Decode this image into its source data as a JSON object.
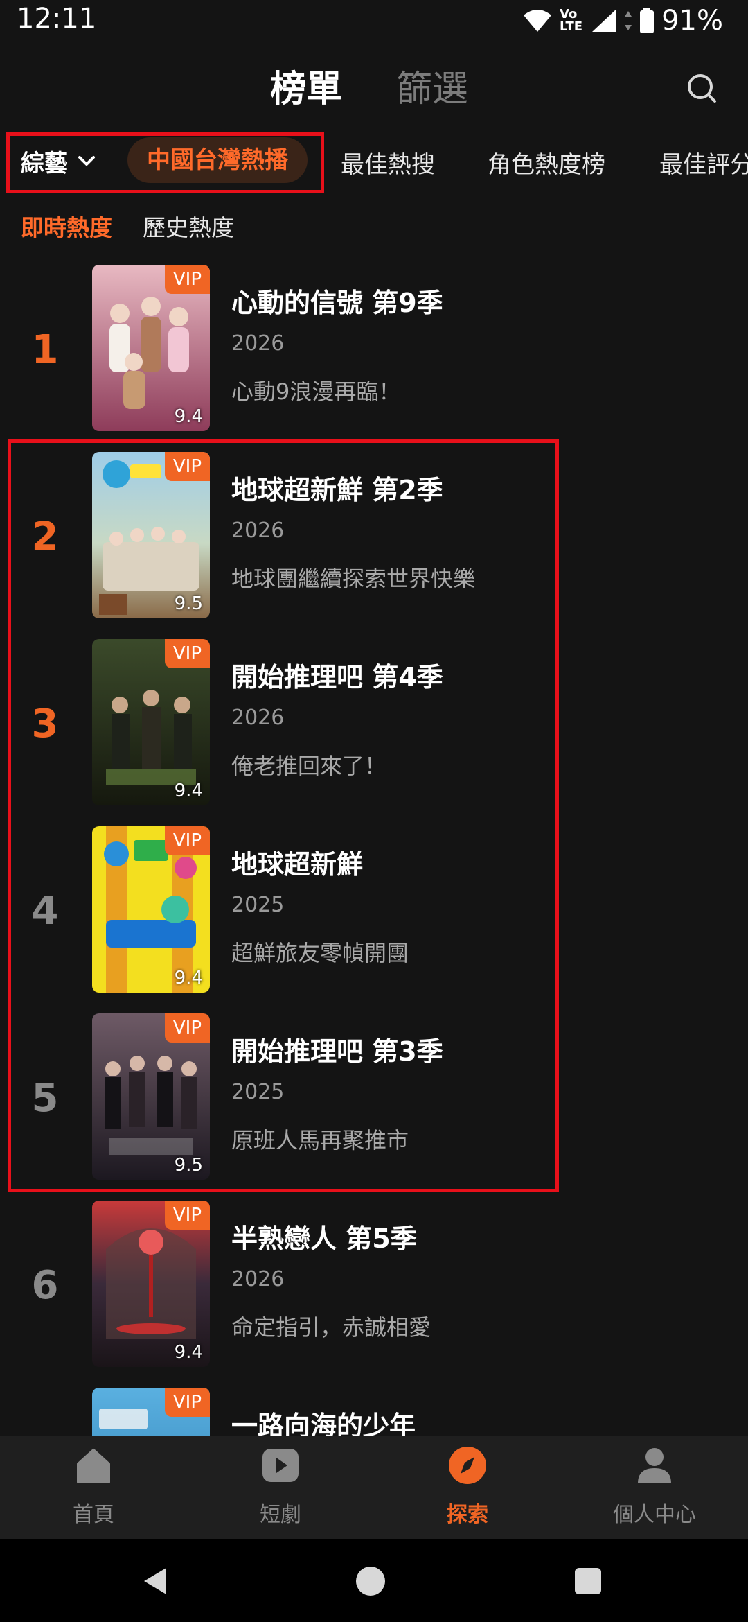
{
  "status_bar": {
    "time": "12:11",
    "battery": "91%"
  },
  "header": {
    "tabs": [
      {
        "label": "榜單",
        "active": true
      },
      {
        "label": "篩選",
        "active": false
      }
    ],
    "search_icon": "search-icon"
  },
  "category_row": {
    "dropdown_label": "綜藝",
    "selected": "中國台灣熱播",
    "items": [
      "最佳熱搜",
      "角色熱度榜",
      "最佳評分"
    ]
  },
  "sub_tabs": [
    {
      "label": "即時熱度",
      "active": true
    },
    {
      "label": "歷史熱度",
      "active": false
    }
  ],
  "rankings": [
    {
      "rank": "1",
      "title": "心動的信號 第9季",
      "year": "2026",
      "desc": "心動9浪漫再臨！",
      "score": "9.4",
      "badge": "VIP"
    },
    {
      "rank": "2",
      "title": "地球超新鮮 第2季",
      "year": "2026",
      "desc": "地球團繼續探索世界快樂",
      "score": "9.5",
      "badge": "VIP"
    },
    {
      "rank": "3",
      "title": "開始推理吧 第4季",
      "year": "2026",
      "desc": "俺老推回來了！",
      "score": "9.4",
      "badge": "VIP"
    },
    {
      "rank": "4",
      "title": "地球超新鮮",
      "year": "2025",
      "desc": "超鮮旅友零幀開團",
      "score": "9.4",
      "badge": "VIP"
    },
    {
      "rank": "5",
      "title": "開始推理吧 第3季",
      "year": "2025",
      "desc": "原班人馬再聚推市",
      "score": "9.5",
      "badge": "VIP"
    },
    {
      "rank": "6",
      "title": "半熟戀人 第5季",
      "year": "2026",
      "desc": "命定指引，赤誠相愛",
      "score": "9.4",
      "badge": "VIP"
    },
    {
      "rank": "",
      "title": "一路向海的少年",
      "year": "",
      "desc": "",
      "score": "",
      "badge": "VIP"
    }
  ],
  "bottom_nav": [
    {
      "label": "首頁",
      "icon": "home-icon",
      "active": false
    },
    {
      "label": "短劇",
      "icon": "play-icon",
      "active": false
    },
    {
      "label": "探索",
      "icon": "compass-icon",
      "active": true
    },
    {
      "label": "個人中心",
      "icon": "person-icon",
      "active": false
    }
  ],
  "colors": {
    "accent": "#f06524",
    "background": "#141414",
    "annotation": "#e8101a"
  }
}
